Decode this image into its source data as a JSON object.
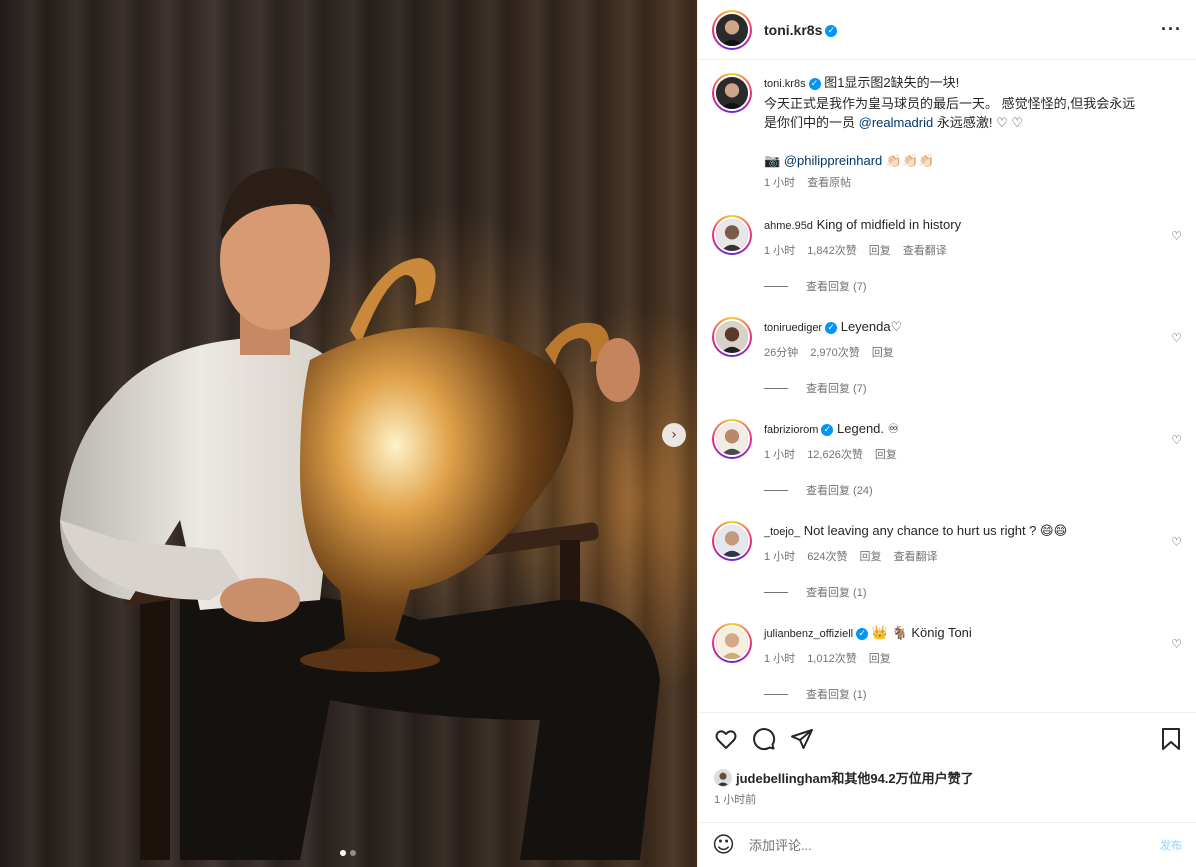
{
  "post": {
    "username": "toni.kr8s",
    "more_icon": "more-horizontal-icon"
  },
  "caption": {
    "username": "toni.kr8s",
    "line1": "图1显示图2缺失的一块!",
    "line2": "今天正式是我作为皇马球员的最后一天。 感觉怪怪的,但我会永远",
    "line3_before": "是你们中的一员 ",
    "line3_mention": "@realmadrid",
    "line3_after": " 永远感激! ♡ ♡",
    "credit_icon": "📷",
    "credit_mention": "@philippreinhard",
    "credit_after": " 👏🏻👏🏻👏🏻",
    "time": "1 小时",
    "see_original": "查看原帖"
  },
  "comments": [
    {
      "username": "ahme.95d",
      "verified": false,
      "text": "King of midfield in history",
      "time": "1 小时",
      "likes": "1,842次赞",
      "reply": "回复",
      "translate": "查看翻译",
      "replies": "查看回复 (7)"
    },
    {
      "username": "toniruediger",
      "verified": true,
      "text": "Leyenda♡",
      "time": "26分钟",
      "likes": "2,970次赞",
      "reply": "回复",
      "translate": "",
      "replies": "查看回复 (7)"
    },
    {
      "username": "fabriziorom",
      "verified": true,
      "text": "Legend. ♾",
      "time": "1 小时",
      "likes": "12,626次赞",
      "reply": "回复",
      "translate": "",
      "replies": "查看回复 (24)"
    },
    {
      "username": "_toejo_",
      "verified": false,
      "text": "Not leaving any chance to hurt us right ? 😄😄",
      "time": "1 小时",
      "likes": "624次赞",
      "reply": "回复",
      "translate": "查看翻译",
      "replies": "查看回复 (1)"
    },
    {
      "username": "julianbenz_offiziell",
      "verified": true,
      "text": "👑 🐐 König Toni",
      "time": "1 小时",
      "likes": "1,012次赞",
      "reply": "回复",
      "translate": "",
      "replies": "查看回复 (1)"
    }
  ],
  "likes_line": "judebellingham和其他94.2万位用户赞了",
  "post_time": "1 小时前",
  "comment_input": {
    "placeholder": "添加评论...",
    "post_label": "发布"
  },
  "carousel": {
    "current": 1,
    "total": 2
  },
  "colors": {
    "accent": "#0095f6",
    "link": "#00376b",
    "muted": "#737373"
  }
}
